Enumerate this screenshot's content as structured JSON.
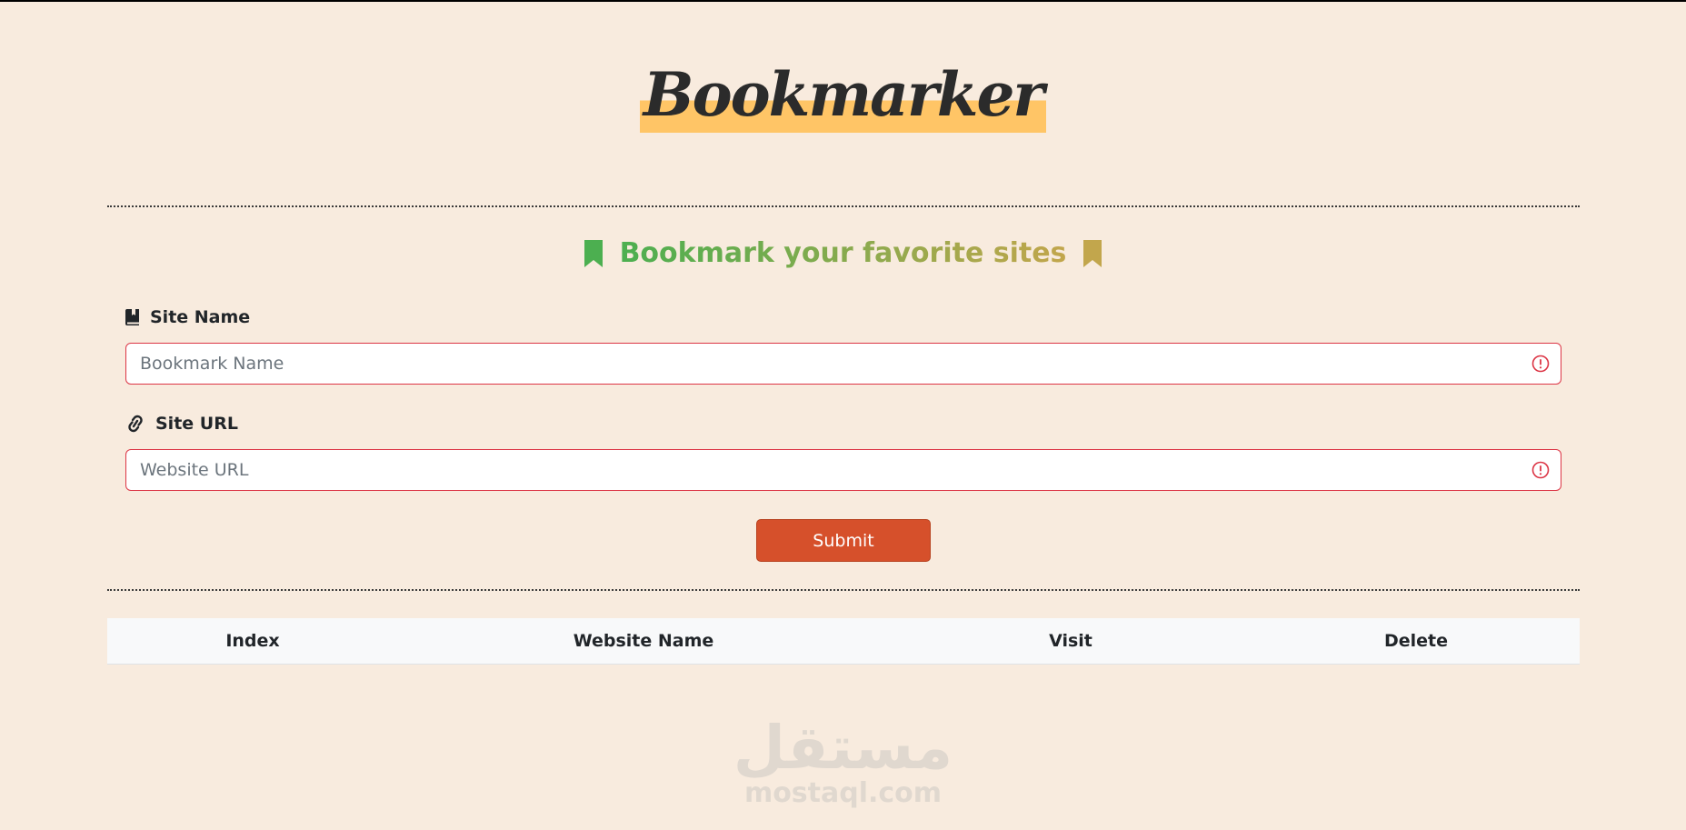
{
  "header": {
    "title": "Bookmarker",
    "title_highlight_color": "#ffc566"
  },
  "tagline": {
    "text": "Bookmark your favorite sites",
    "left_icon": "bookmark-icon",
    "right_icon": "bookmark-icon",
    "gradient_start": "#4caf50",
    "gradient_end": "#c2a64c"
  },
  "form": {
    "site_name": {
      "label": "Site Name",
      "icon": "book-bookmark-icon",
      "placeholder": "Bookmark Name",
      "value": ""
    },
    "site_url": {
      "label": "Site URL",
      "icon": "link-icon",
      "placeholder": "Website URL",
      "value": ""
    },
    "invalid_border_color": "#dc3545",
    "submit_label": "Submit",
    "submit_color": "#d6502b"
  },
  "table": {
    "headers": [
      "Index",
      "Website Name",
      "Visit",
      "Delete"
    ],
    "rows": []
  },
  "watermark": {
    "arabic": "مستقل",
    "latin": "mostaql.com"
  },
  "colors": {
    "background": "#f8ebde"
  }
}
